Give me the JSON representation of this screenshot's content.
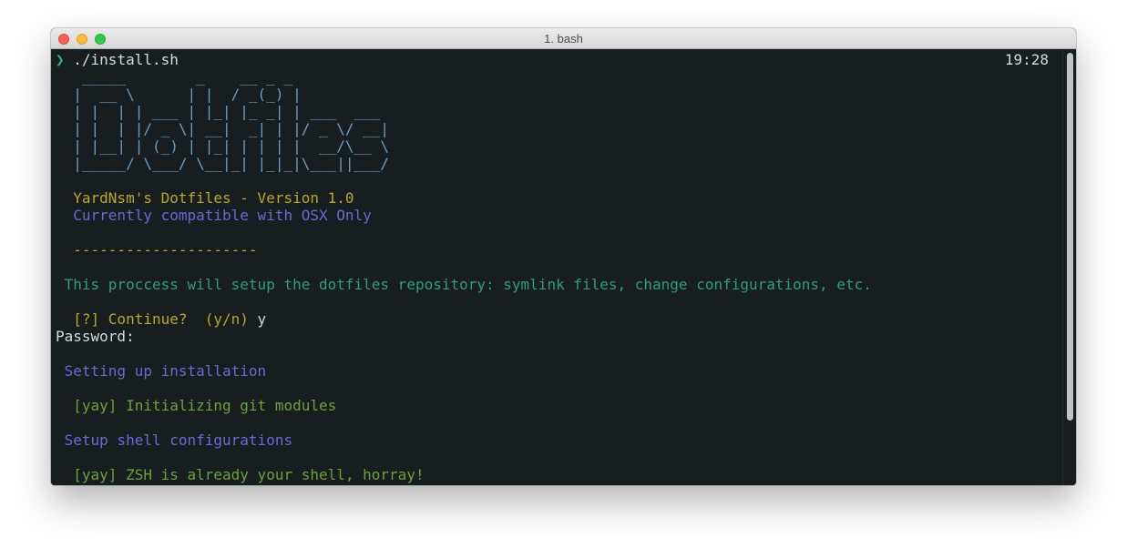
{
  "window": {
    "title": "1. bash"
  },
  "terminal": {
    "clock": "19:28",
    "prompt_symbol": "❯",
    "command": " ./install.sh",
    "banner": [
      "   _____        _    __ _ _",
      "  |  __ \\      | |  / _(_) |",
      "  | |  | | ___ | |_| |_ _| | ___  ___",
      "  | |  | |/ _ \\| __|  _| | |/ _ \\/ __|",
      "  | |__| | (_) | |_| | | | |  __/\\__ \\",
      "  |_____/ \\___/ \\__|_| |_|_|\\___||___/"
    ],
    "version_line": "  YardNsm's Dotfiles - Version 1.0",
    "compat_line": "  Currently compatible with OSX Only",
    "separator": "  ---------------------",
    "description": " This proccess will setup the dotfiles repository: symlink files, change configurations, etc.",
    "continue_prompt": "  [?] Continue?  (y/n)",
    "continue_answer": " y",
    "password": "Password:",
    "setup_install": " Setting up installation",
    "git_modules": "  [yay] Initializing git modules",
    "shell_config": " Setup shell configurations",
    "zsh_line": "  [yay] ZSH is already your shell, horray!"
  },
  "colors": {
    "background": "#181d20",
    "prompt": "#2fb574",
    "banner": "#6a9fc4",
    "yellow": "#b9a82a",
    "purple": "#6a6ad6",
    "green": "#2e9f7b",
    "yay": "#69a33b"
  }
}
